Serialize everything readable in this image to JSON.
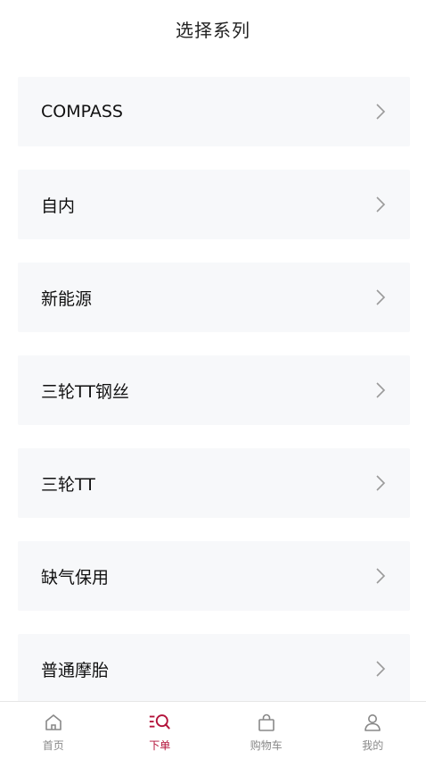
{
  "header": {
    "title": "选择系列"
  },
  "series_list": {
    "items": [
      {
        "label": "COMPASS"
      },
      {
        "label": "自内"
      },
      {
        "label": "新能源"
      },
      {
        "label": "三轮TT钢丝"
      },
      {
        "label": "三轮TT"
      },
      {
        "label": "缺气保用"
      },
      {
        "label": "普通摩胎"
      }
    ]
  },
  "tabbar": {
    "tabs": [
      {
        "label": "首页",
        "icon": "home-icon",
        "active": false
      },
      {
        "label": "下单",
        "icon": "order-search-icon",
        "active": true
      },
      {
        "label": "购物车",
        "icon": "shopping-bag-icon",
        "active": false
      },
      {
        "label": "我的",
        "icon": "user-icon",
        "active": false
      }
    ]
  },
  "colors": {
    "accent": "#b3123a",
    "card_bg": "#f7f8fa",
    "inactive_tab": "#888888",
    "chevron": "#9a9a9a"
  }
}
